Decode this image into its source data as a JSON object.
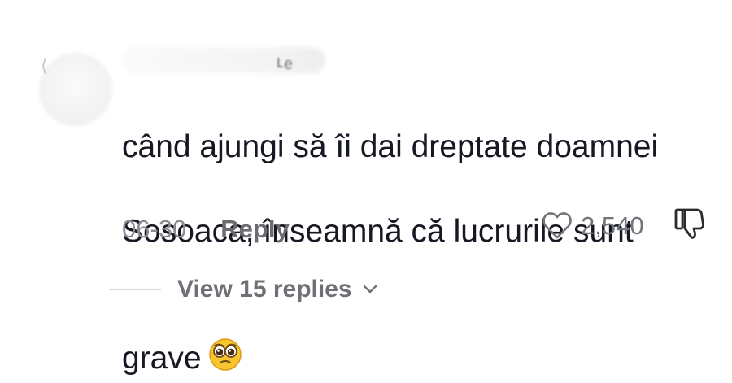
{
  "comment": {
    "text_lines": [
      "când ajungi să îi dai dreptate doamnei",
      "Sosoaca, înseamnă că lucrurile sunt",
      "grave"
    ],
    "emoji": "pleading-face-emoji",
    "date": "06-30",
    "reply_label": "Reply",
    "like_count": "2,540",
    "view_replies_label": "View 15 replies",
    "icons": {
      "like": "heart-icon",
      "dislike": "thumbs-down-icon",
      "chevron": "chevron-down-icon"
    },
    "colors": {
      "text": "#161823",
      "secondary": "#8a8b91",
      "muted_bold": "#6c6c70"
    }
  }
}
